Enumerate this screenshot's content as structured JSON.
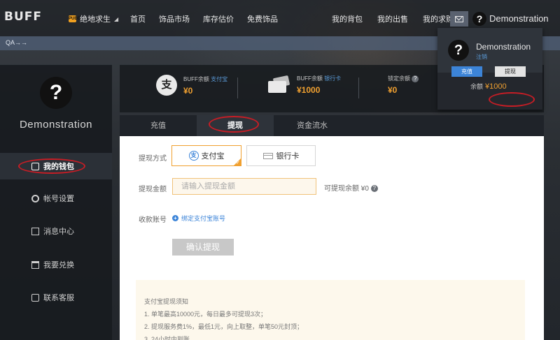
{
  "brand": {
    "logo": "BUFF"
  },
  "topnav": {
    "game_badge": "PUBG",
    "game_select": "绝地求生",
    "links": [
      "首页",
      "饰品市场",
      "库存估价",
      "免费饰品"
    ],
    "right_links": [
      "我的背包",
      "我的出售",
      "我的求购"
    ],
    "avatar_glyph": "?",
    "username": "Demonstration"
  },
  "qabar": {
    "text": "QA→→"
  },
  "sidebar": {
    "avatar_glyph": "?",
    "username": "Demonstration",
    "items": [
      {
        "label": "我的钱包",
        "icon": "wallet-icon",
        "active": true
      },
      {
        "label": "帐号设置",
        "icon": "gear-icon",
        "active": false
      },
      {
        "label": "消息中心",
        "icon": "message-icon",
        "active": false
      },
      {
        "label": "我要兑换",
        "icon": "gift-icon",
        "active": false
      },
      {
        "label": "联系客服",
        "icon": "support-icon",
        "active": false
      }
    ]
  },
  "balances": {
    "alipay": {
      "icon_glyph": "支",
      "label": "BUFF余额",
      "link": "支付宝",
      "amount": "¥0"
    },
    "bank": {
      "label": "BUFF余额",
      "link": "银行卡",
      "amount": "¥1000"
    },
    "locked": {
      "label": "锁定余额",
      "help": "?",
      "amount": "¥0"
    }
  },
  "popup": {
    "avatar_glyph": "?",
    "username": "Demonstration",
    "logout": "注销",
    "balance_label": "余额",
    "balance_amount": "¥1000",
    "recharge_btn": "充值",
    "withdraw_btn": "提现"
  },
  "tabs": [
    "充值",
    "提现",
    "资金流水"
  ],
  "active_tab": "提现",
  "form": {
    "method_label": "提现方式",
    "methods": [
      {
        "label": "支付宝",
        "icon_glyph": "支",
        "selected": true
      },
      {
        "label": "银行卡",
        "selected": false
      }
    ],
    "amount_label": "提现金额",
    "amount_placeholder": "请输入提现金额",
    "withdrawable_text": "可提现余额 ¥0",
    "help": "?",
    "account_label": "收款账号",
    "bind_link": "绑定支付宝账号",
    "confirm_btn": "确认提现"
  },
  "notice": {
    "title": "支付宝提现须知",
    "lines": [
      "1. 单笔最高10000元，每日最多可提现3次；",
      "2. 提现服务费1%，最低1元，向上取整，单笔50元封顶；",
      "3. 24小时内到账。"
    ]
  },
  "colors": {
    "accent_orange": "#f0a030",
    "link_blue": "#3c84d8",
    "annotation_red": "#c81d25"
  }
}
